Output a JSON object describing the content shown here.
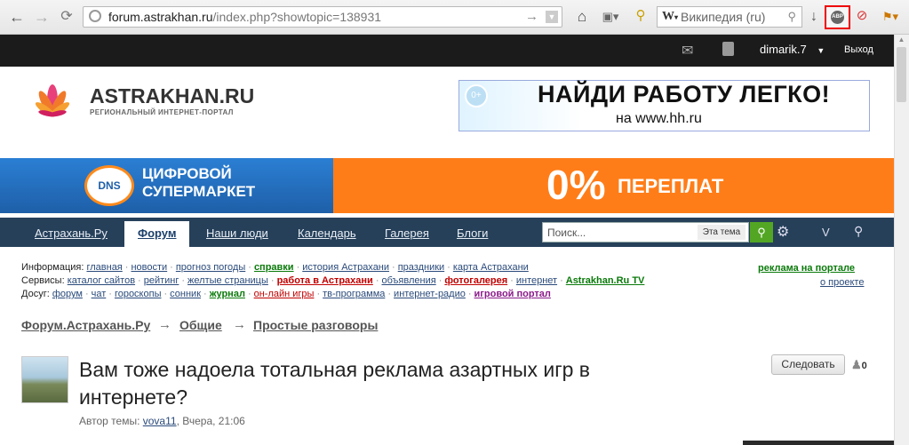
{
  "browser": {
    "url_domain": "forum.astrakhan.ru",
    "url_path": "/index.php?showtopic=138931",
    "search_placeholder": "Википедия (ru)",
    "adblock_label": "ABP"
  },
  "site_bar": {
    "username": "dimarik.7",
    "logout": "Выход"
  },
  "header": {
    "logo_name": "ASTRAKHAN.RU",
    "logo_subtitle": "РЕГИОНАЛЬНЫЙ ИНТЕРНЕТ-ПОРТАЛ",
    "hh_banner": {
      "age": "0+",
      "title": "НАЙДИ РАБОТУ ЛЕГКО!",
      "subtitle": "на www.hh.ru"
    }
  },
  "promo_banner": {
    "logo": "DNS",
    "line1": "ЦИФРОВОЙ",
    "line2": "СУПЕРМАРКЕТ",
    "big": "0%",
    "word": "ПЕРЕПЛАТ"
  },
  "nav": {
    "tabs": [
      "Астрахань.Ру",
      "Форум",
      "Наши люди",
      "Календарь",
      "Галерея",
      "Блоги"
    ],
    "active_index": 1,
    "search_placeholder": "Поиск...",
    "search_scope": "Эта тема",
    "extra_labels": [
      "V"
    ]
  },
  "info": {
    "line1_label": "Информация:",
    "line1": [
      "главная",
      "новости",
      "прогноз погоды",
      "справки",
      "история Астрахани",
      "праздники",
      "карта Астрахани"
    ],
    "line2_label": "Сервисы:",
    "line2": [
      "каталог сайтов",
      "рейтинг",
      "желтые страницы",
      "работа в Астрахани",
      "объявления",
      "фотогалерея",
      "интернет",
      "Astrakhan.Ru TV"
    ],
    "line3_label": "Досуг:",
    "line3": [
      "форум",
      "чат",
      "гороскопы",
      "сонник",
      "журнал",
      "он-лайн игры",
      "тв-программа",
      "интернет-радио",
      "игровой портал"
    ],
    "ad_link": "реклама на портале",
    "about_link": "о проекте"
  },
  "breadcrumb": [
    "Форум.Астрахань.Ру",
    "Общие",
    "Простые разговоры"
  ],
  "topic": {
    "title": "Вам тоже надоела тотальная реклама азартных игр в интернете?",
    "author_label": "Автор темы:",
    "author": "vova11",
    "date": "Вчера, 21:06",
    "follow": "Следовать",
    "followers": "0"
  },
  "colors": {
    "nav_bg": "#26405a",
    "site_bar_bg": "#1b1b1b",
    "promo_orange": "#ff7d18",
    "promo_blue": "#1e5fa8",
    "link_green": "#0a7a0a",
    "link_red": "#c00000"
  }
}
